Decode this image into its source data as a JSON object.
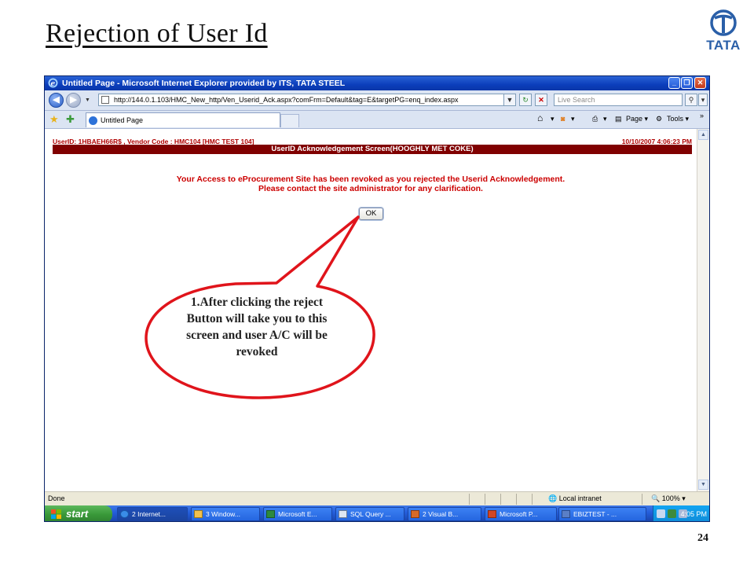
{
  "slide": {
    "title": "Rejection of User Id",
    "logo_text": "TATA",
    "page_number": "24"
  },
  "window": {
    "title": "Untitled Page - Microsoft Internet Explorer provided by ITS, TATA STEEL",
    "address": "http://144.0.1.103/HMC_New_http/Ven_Userid_Ack.aspx?comFrm=Default&tag=E&targetPG=enq_index.aspx",
    "search_placeholder": "Live Search",
    "tab_label": "Untitled Page",
    "commands": {
      "page": "Page",
      "tools": "Tools"
    }
  },
  "content": {
    "user_info": "UserID: 1HBAEH66R$ , Vendor Code : HMC104 [HMC TEST 104]",
    "datetime": "10/10/2007 4:06:23 PM",
    "header": "UserID Acknowledgement Screen(HOOGHLY MET COKE)",
    "message_line1": "Your Access to eProcurement Site has been revoked as you rejected the Userid Acknowledgement.",
    "message_line2": "Please contact the site administrator for any clarification.",
    "ok_label": "OK"
  },
  "statusbar": {
    "status": "Done",
    "zone": "Local intranet",
    "zoom": "100%"
  },
  "taskbar": {
    "start": "start",
    "tasks": [
      "2 Internet...",
      "3 Window...",
      "Microsoft E...",
      "SQL Query ...",
      "2 Visual B...",
      "Microsoft P...",
      "EBIZTEST - ..."
    ],
    "clock": "4:05 PM"
  },
  "callout": {
    "text": "1.After clicking the reject Button  will take you to this screen and user A/C will be revoked",
    "color": "#e0141b"
  }
}
